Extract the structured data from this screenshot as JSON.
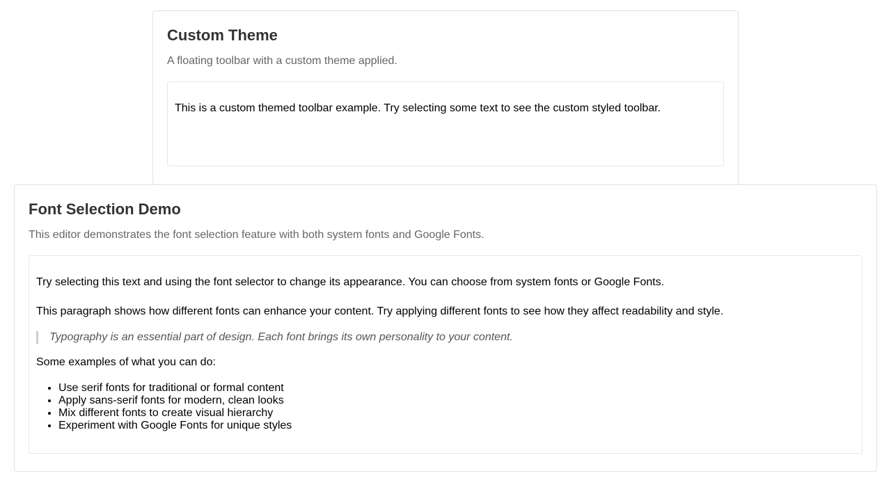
{
  "custom_theme": {
    "title": "Custom Theme",
    "description": "A floating toolbar with a custom theme applied.",
    "editor_text": "This is a custom themed toolbar example. Try selecting some text to see the custom styled toolbar."
  },
  "font_demo": {
    "title": "Font Selection Demo",
    "description": "This editor demonstrates the font selection feature with both system fonts and Google Fonts.",
    "paragraph_1": "Try selecting this text and using the font selector to change its appearance. You can choose from system fonts or Google Fonts.",
    "paragraph_2": "This paragraph shows how different fonts can enhance your content. Try applying different fonts to see how they affect readability and style.",
    "quote": "Typography is an essential part of design. Each font brings its own personality to your content.",
    "examples_intro": "Some examples of what you can do:",
    "examples": [
      "Use serif fonts for traditional or formal content",
      "Apply sans-serif fonts for modern, clean looks",
      "Mix different fonts to create visual hierarchy",
      "Experiment with Google Fonts for unique styles"
    ]
  }
}
